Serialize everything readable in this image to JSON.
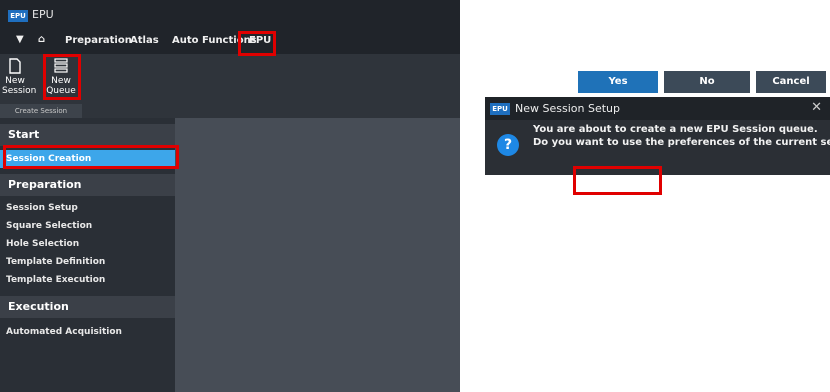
{
  "app": {
    "logo": "EPU",
    "title": "EPU",
    "menu": [
      "Preparation",
      "Atlas",
      "Auto Functions",
      "EPU"
    ],
    "ribbon_buttons": [
      {
        "label1": "New",
        "label2": "Session",
        "icon": "document-icon"
      },
      {
        "label1": "New",
        "label2": "Queue",
        "icon": "queue-icon"
      }
    ],
    "ribbon_group": "Create Session",
    "sections": {
      "start": {
        "title": "Start",
        "items": [
          "Session Creation"
        ]
      },
      "preparation": {
        "title": "Preparation",
        "items": [
          "Session Setup",
          "Square Selection",
          "Hole Selection",
          "Template Definition",
          "Template Execution"
        ]
      },
      "execution": {
        "title": "Execution",
        "items": [
          "Automated Acquisition"
        ]
      }
    }
  },
  "dialog": {
    "logo": "EPU",
    "title": "New Session Setup",
    "line1": "You are about to create a new EPU Session queue.",
    "line2": "Do you want to use the preferences of the current session?",
    "buttons": {
      "yes": "Yes",
      "no": "No",
      "cancel": "Cancel"
    }
  },
  "colors": {
    "highlight": "#e00000",
    "active": "#3da6ea",
    "accent": "#1f72b8"
  }
}
